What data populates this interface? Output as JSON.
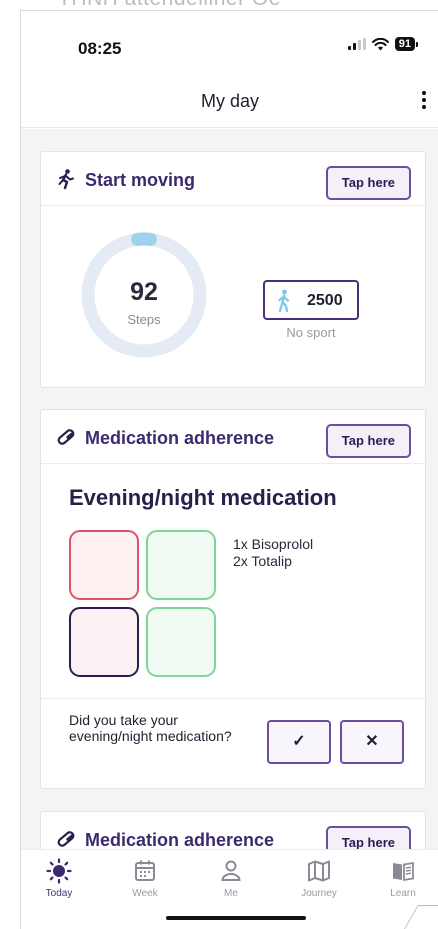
{
  "top_clipped_text": "THNH attendelliner Oe",
  "status": {
    "time": "08:25",
    "battery": "91"
  },
  "header": {
    "title": "My day"
  },
  "steps_card": {
    "title": "Start moving",
    "button": "Tap here",
    "steps_value": "92",
    "steps_label": "Steps",
    "steps_progress_fraction": 0.037,
    "goal_value": "2500",
    "goal_label": "No sport"
  },
  "med_card": {
    "title": "Medication adherence",
    "button": "Tap here",
    "heading": "Evening/night medication",
    "medications": [
      "1x Bisoprolol",
      "2x Totalip"
    ],
    "question": "Did you take your evening/night medication?",
    "yes_glyph": "✓",
    "no_glyph": "✕"
  },
  "med_card_2": {
    "title": "Medication adherence",
    "button": "Tap here"
  },
  "tabs": [
    {
      "label": "Today",
      "icon": "sun-icon",
      "active": true
    },
    {
      "label": "Week",
      "icon": "calendar-icon",
      "active": false
    },
    {
      "label": "Me",
      "icon": "person-icon",
      "active": false
    },
    {
      "label": "Journey",
      "icon": "map-icon",
      "active": false
    },
    {
      "label": "Learn",
      "icon": "book-icon",
      "active": false
    }
  ],
  "colors": {
    "accent": "#4a2f7a",
    "ring_track": "#e4ebf5",
    "ring_progress": "#9fd0ee",
    "pill_red": "#d9566a",
    "pill_green": "#7fd49a"
  }
}
